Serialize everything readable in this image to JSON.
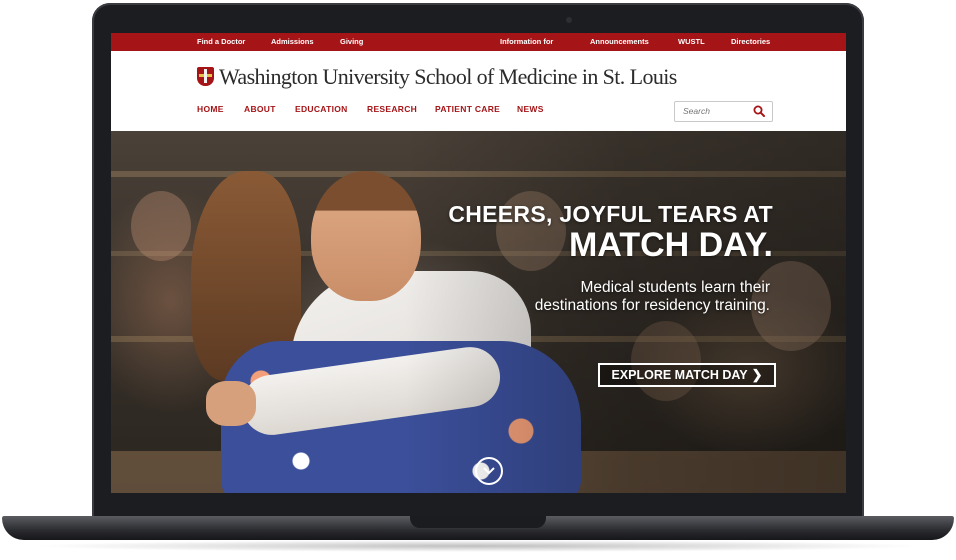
{
  "utility_nav": [
    "Find a Doctor",
    "Admissions",
    "Giving",
    "Information for",
    "Announcements",
    "WUSTL",
    "Directories"
  ],
  "brand": {
    "name": "Washington University School of Medicine in St. Louis",
    "crest_icon": "university-crest-icon"
  },
  "main_nav": [
    "HOME",
    "ABOUT",
    "EDUCATION",
    "RESEARCH",
    "PATIENT CARE",
    "NEWS"
  ],
  "search": {
    "placeholder": "Search",
    "icon": "search-icon"
  },
  "hero": {
    "headline_line1": "CHEERS, JOYFUL TEARS AT",
    "headline_line2": "MATCH DAY.",
    "subtext": "Medical students learn their destinations for residency training.",
    "cta_label": "EXPLORE MATCH DAY",
    "cta_icon": "chevron-right-icon",
    "scroll_icon": "chevron-down-circle-icon"
  },
  "colors": {
    "brand_red": "#a51417",
    "text_dark": "#2b2b2b",
    "white": "#ffffff"
  }
}
